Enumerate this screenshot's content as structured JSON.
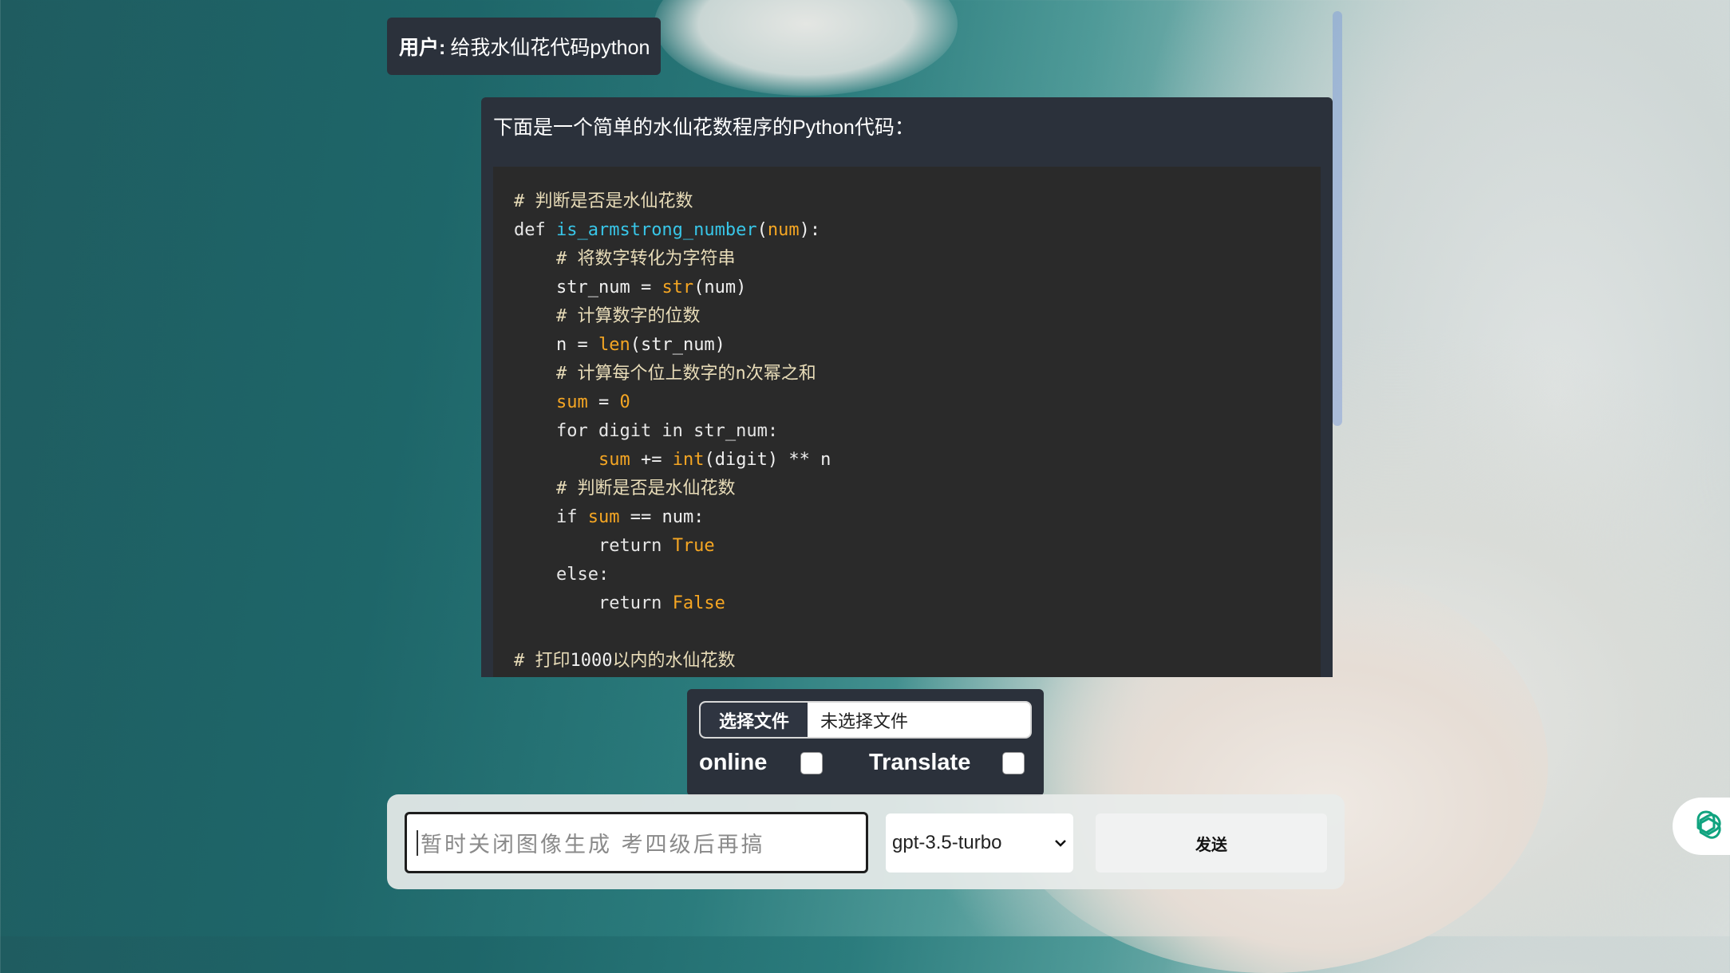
{
  "chat": {
    "user_message": {
      "speaker": "用户:",
      "text": "给我水仙花代码python"
    },
    "assistant_message": {
      "intro": "下面是一个简单的水仙花数程序的Python代码：",
      "code_lines": [
        [
          {
            "t": "# 判断是否是水仙花数",
            "c": "t-c"
          }
        ],
        [
          {
            "t": "def ",
            "c": "t-k"
          },
          {
            "t": "is_armstrong_number",
            "c": "t-f"
          },
          {
            "t": "(",
            "c": "t-p"
          },
          {
            "t": "num",
            "c": "t-o"
          },
          {
            "t": "):",
            "c": "t-p"
          }
        ],
        [
          {
            "t": "    # 将数字转化为字符串",
            "c": "t-c"
          }
        ],
        [
          {
            "t": "    str_num = ",
            "c": "t-p"
          },
          {
            "t": "str",
            "c": "t-o"
          },
          {
            "t": "(num)",
            "c": "t-p"
          }
        ],
        [
          {
            "t": "    # 计算数字的位数",
            "c": "t-c"
          }
        ],
        [
          {
            "t": "    n = ",
            "c": "t-p"
          },
          {
            "t": "len",
            "c": "t-o"
          },
          {
            "t": "(str_num)",
            "c": "t-p"
          }
        ],
        [
          {
            "t": "    # 计算每个位上数字的n次幂之和",
            "c": "t-c"
          }
        ],
        [
          {
            "t": "    ",
            "c": "t-p"
          },
          {
            "t": "sum",
            "c": "t-o"
          },
          {
            "t": " = ",
            "c": "t-p"
          },
          {
            "t": "0",
            "c": "t-o"
          }
        ],
        [
          {
            "t": "    for digit in str_num:",
            "c": "t-k"
          }
        ],
        [
          {
            "t": "        ",
            "c": "t-p"
          },
          {
            "t": "sum",
            "c": "t-o"
          },
          {
            "t": " += ",
            "c": "t-p"
          },
          {
            "t": "int",
            "c": "t-o"
          },
          {
            "t": "(digit) ** n",
            "c": "t-p"
          }
        ],
        [
          {
            "t": "    # 判断是否是水仙花数",
            "c": "t-c"
          }
        ],
        [
          {
            "t": "    if ",
            "c": "t-k"
          },
          {
            "t": "sum",
            "c": "t-o"
          },
          {
            "t": " == num:",
            "c": "t-p"
          }
        ],
        [
          {
            "t": "        return ",
            "c": "t-k"
          },
          {
            "t": "True",
            "c": "t-o"
          }
        ],
        [
          {
            "t": "    else:",
            "c": "t-k"
          }
        ],
        [
          {
            "t": "        return ",
            "c": "t-k"
          },
          {
            "t": "False",
            "c": "t-o"
          }
        ],
        [
          {
            "t": "",
            "c": "t-p"
          }
        ],
        [
          {
            "t": "# 打印",
            "c": "t-c"
          },
          {
            "t": "1000",
            "c": "t-p"
          },
          {
            "t": "以内的水仙花数",
            "c": "t-c"
          }
        ]
      ]
    }
  },
  "upload": {
    "choose_file_label": "选择文件",
    "file_status": "未选择文件"
  },
  "options": {
    "online_label": "online",
    "online_checked": false,
    "translate_label": "Translate",
    "translate_checked": false
  },
  "composer": {
    "placeholder": "暂时关闭图像生成 考四级后再搞",
    "model_selected": "gpt-3.5-turbo",
    "send_label": "发送"
  },
  "colors": {
    "panel_bg": "#2b313b",
    "code_bg": "#2a2a2a",
    "accent_orange": "#f5a623",
    "accent_cyan": "#38c6e8",
    "openai_green": "#10a37f"
  }
}
